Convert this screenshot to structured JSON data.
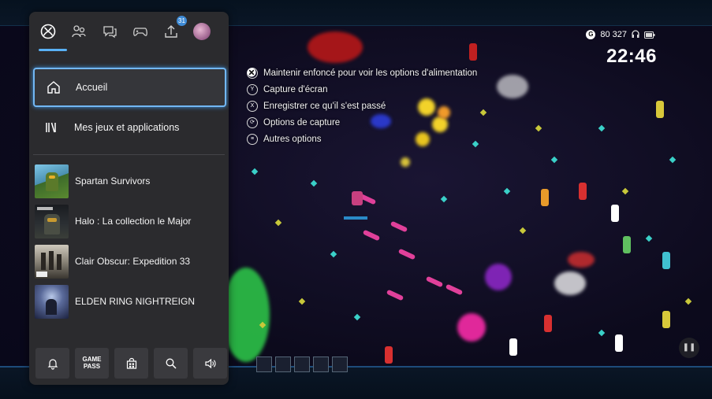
{
  "guide": {
    "tabs": [
      {
        "name": "xbox-home",
        "badge": ""
      },
      {
        "name": "people",
        "badge": ""
      },
      {
        "name": "messages",
        "badge": ""
      },
      {
        "name": "controller",
        "badge": ""
      },
      {
        "name": "uploads",
        "badge": "31"
      },
      {
        "name": "profile",
        "badge": ""
      }
    ],
    "nav": [
      {
        "label": "Accueil",
        "icon": "home-icon",
        "selected": true
      },
      {
        "label": "Mes jeux et applications",
        "icon": "library-icon",
        "selected": false
      }
    ],
    "recent_games": [
      {
        "title": "Spartan Survivors"
      },
      {
        "title": "Halo : La collection le Major"
      },
      {
        "title": "Clair Obscur: Expedition 33"
      },
      {
        "title": "ELDEN RING NIGHTREIGN"
      }
    ],
    "quickbar": [
      {
        "name": "notifications",
        "icon": "bell-icon"
      },
      {
        "name": "game-pass",
        "label_line1": "GAME",
        "label_line2": "PASS"
      },
      {
        "name": "store",
        "icon": "store-icon"
      },
      {
        "name": "search",
        "icon": "search-icon"
      },
      {
        "name": "audio",
        "icon": "speaker-icon"
      }
    ]
  },
  "capture_menu": [
    {
      "label": "Maintenir enfoncé pour voir les options d'alimentation",
      "icon": "xbox-icon"
    },
    {
      "label": "Capture d'écran",
      "icon": "y-button-icon",
      "glyph": "Y"
    },
    {
      "label": "Enregistrer ce qu'il s'est passé",
      "icon": "x-button-icon",
      "glyph": "X"
    },
    {
      "label": "Options de capture",
      "icon": "share-icon",
      "glyph": "⟳"
    },
    {
      "label": "Autres options",
      "icon": "menu-icon",
      "glyph": "≡"
    }
  ],
  "status": {
    "gamerscore": "80 327",
    "time": "22:46"
  },
  "colors": {
    "accent": "#59b1f5",
    "panel": "#2b2b2e"
  }
}
